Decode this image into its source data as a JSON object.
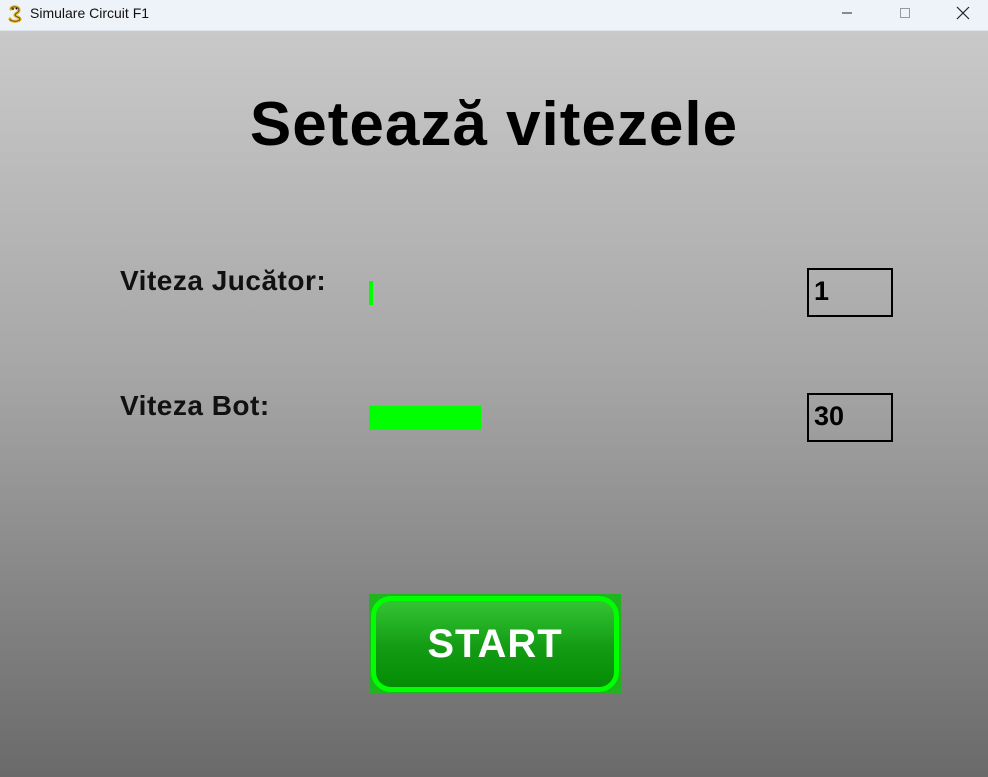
{
  "window": {
    "title": "Simulare Circuit F1",
    "app_icon": "pygame-snake-icon",
    "controls": {
      "minimize": "minimize-icon",
      "maximize": "maximize-icon",
      "close": "close-icon"
    }
  },
  "screen": {
    "heading": "Setează vitezele",
    "rows": [
      {
        "label": "Viteza Jucător:",
        "value": "1",
        "bar_fraction": 0.01
      },
      {
        "label": "Viteza Bot:",
        "value": "30",
        "bar_fraction": 0.28
      }
    ],
    "start_label": "START"
  },
  "colors": {
    "bar_fill": "#00ff00",
    "button_border": "#00ff00",
    "button_fill": "#139b13",
    "button_text": "#ffffff",
    "background_top": "#c9c9c9",
    "background_bottom": "#6a6a6a"
  }
}
